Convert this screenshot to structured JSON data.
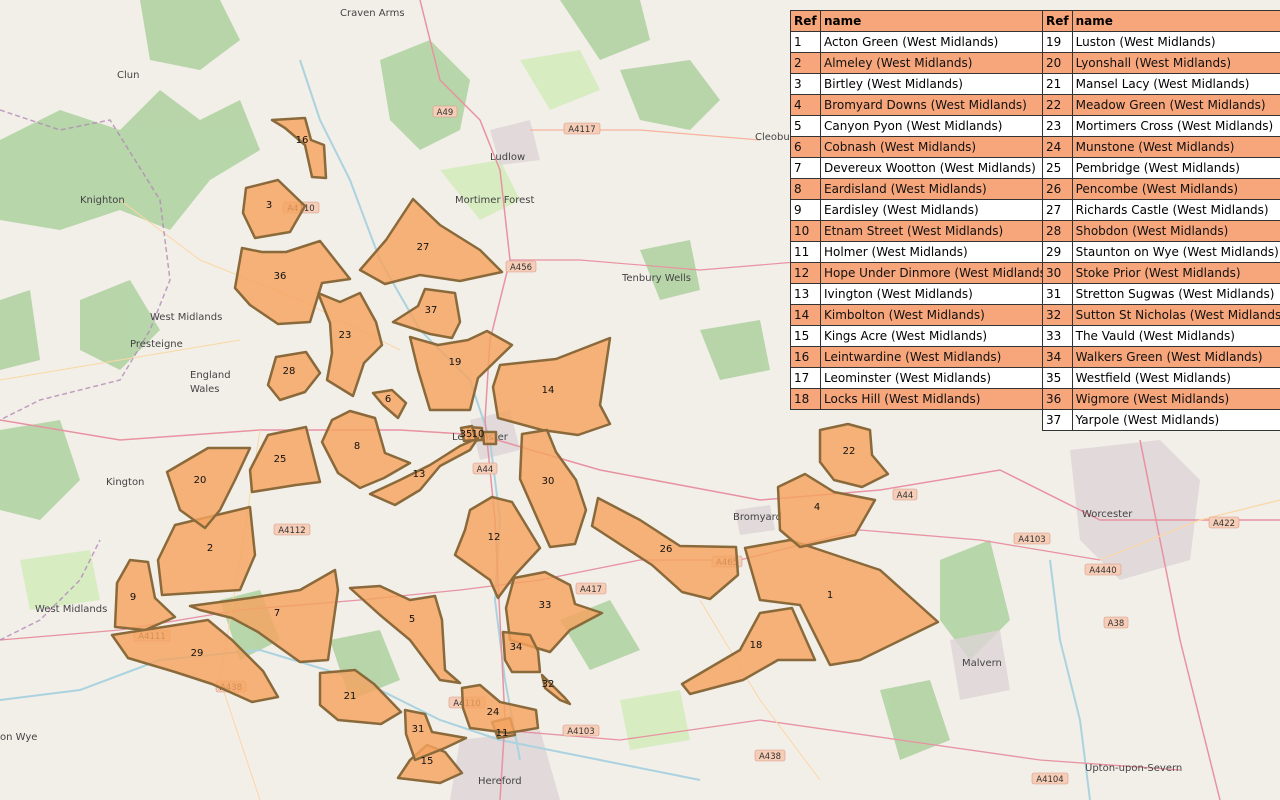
{
  "colors": {
    "area_fill": "#f5a35f",
    "area_stroke": "#8a6a3a",
    "table_header": "#f7a57a",
    "table_alt_row": "#f7a57a"
  },
  "map": {
    "places": [
      {
        "name": "Craven Arms"
      },
      {
        "name": "Clun"
      },
      {
        "name": "Knighton"
      },
      {
        "name": "Ludlow"
      },
      {
        "name": "Mortimer Forest"
      },
      {
        "name": "Cleobury"
      },
      {
        "name": "Tenbury Wells"
      },
      {
        "name": "Presteigne"
      },
      {
        "name": "England"
      },
      {
        "name": "Wales"
      },
      {
        "name": "Kington"
      },
      {
        "name": "Leominster"
      },
      {
        "name": "Bromyard"
      },
      {
        "name": "Worcester"
      },
      {
        "name": "Malvern"
      },
      {
        "name": "Hereford"
      },
      {
        "name": "Upton-upon-Severn"
      },
      {
        "name": "West Midlands"
      },
      {
        "name": "West Midlands"
      },
      {
        "name": "on Wye"
      }
    ],
    "roads": [
      "A49",
      "A4117",
      "A4110",
      "A456",
      "A4112",
      "A44",
      "A4103",
      "A4111",
      "A438",
      "A417",
      "A465",
      "A4440",
      "A38",
      "A422",
      "A4104",
      "A4110",
      "A4103",
      "A438",
      "A44"
    ]
  },
  "legend": {
    "ref_header": "Ref",
    "name_header": "name",
    "left_rows": [
      {
        "ref": "1",
        "name": "Acton Green (West Midlands)"
      },
      {
        "ref": "2",
        "name": "Almeley (West Midlands)"
      },
      {
        "ref": "3",
        "name": "Birtley (West Midlands)"
      },
      {
        "ref": "4",
        "name": "Bromyard Downs (West Midlands)"
      },
      {
        "ref": "5",
        "name": "Canyon Pyon (West Midlands)"
      },
      {
        "ref": "6",
        "name": "Cobnash (West Midlands)"
      },
      {
        "ref": "7",
        "name": "Devereux Wootton (West Midlands)"
      },
      {
        "ref": "8",
        "name": "Eardisland (West Midlands)"
      },
      {
        "ref": "9",
        "name": "Eardisley (West Midlands)"
      },
      {
        "ref": "10",
        "name": "Etnam Street (West Midlands)"
      },
      {
        "ref": "11",
        "name": "Holmer (West Midlands)"
      },
      {
        "ref": "12",
        "name": "Hope Under Dinmore (West Midlands)"
      },
      {
        "ref": "13",
        "name": "Ivington (West Midlands)"
      },
      {
        "ref": "14",
        "name": "Kimbolton (West Midlands)"
      },
      {
        "ref": "15",
        "name": "Kings Acre (West Midlands)"
      },
      {
        "ref": "16",
        "name": "Leintwardine (West Midlands)"
      },
      {
        "ref": "17",
        "name": "Leominster (West Midlands)"
      },
      {
        "ref": "18",
        "name": "Locks Hill (West Midlands)"
      }
    ],
    "right_rows": [
      {
        "ref": "19",
        "name": "Luston (West Midlands)"
      },
      {
        "ref": "20",
        "name": "Lyonshall (West Midlands)"
      },
      {
        "ref": "21",
        "name": "Mansel Lacy (West Midlands)"
      },
      {
        "ref": "22",
        "name": "Meadow Green (West Midlands)"
      },
      {
        "ref": "23",
        "name": "Mortimers Cross (West Midlands)"
      },
      {
        "ref": "24",
        "name": "Munstone (West Midlands)"
      },
      {
        "ref": "25",
        "name": "Pembridge (West Midlands)"
      },
      {
        "ref": "26",
        "name": "Pencombe (West Midlands)"
      },
      {
        "ref": "27",
        "name": "Richards Castle (West Midlands)"
      },
      {
        "ref": "28",
        "name": "Shobdon (West Midlands)"
      },
      {
        "ref": "29",
        "name": "Staunton on Wye (West Midlands)"
      },
      {
        "ref": "30",
        "name": "Stoke Prior (West Midlands)"
      },
      {
        "ref": "31",
        "name": "Stretton Sugwas (West Midlands)"
      },
      {
        "ref": "32",
        "name": "Sutton St Nicholas (West Midlands)"
      },
      {
        "ref": "33",
        "name": "The Vauld (West Midlands)"
      },
      {
        "ref": "34",
        "name": "Walkers Green (West Midlands)"
      },
      {
        "ref": "35",
        "name": "Westfield (West Midlands)"
      },
      {
        "ref": "36",
        "name": "Wigmore (West Midlands)"
      },
      {
        "ref": "37",
        "name": "Yarpole (West Midlands)"
      }
    ]
  },
  "areas": [
    {
      "ref": "1"
    },
    {
      "ref": "2"
    },
    {
      "ref": "3"
    },
    {
      "ref": "4"
    },
    {
      "ref": "5"
    },
    {
      "ref": "6"
    },
    {
      "ref": "7"
    },
    {
      "ref": "8"
    },
    {
      "ref": "9"
    },
    {
      "ref": "10"
    },
    {
      "ref": "11"
    },
    {
      "ref": "12"
    },
    {
      "ref": "13"
    },
    {
      "ref": "14"
    },
    {
      "ref": "15"
    },
    {
      "ref": "16"
    },
    {
      "ref": "17"
    },
    {
      "ref": "18"
    },
    {
      "ref": "19"
    },
    {
      "ref": "20"
    },
    {
      "ref": "21"
    },
    {
      "ref": "22"
    },
    {
      "ref": "23"
    },
    {
      "ref": "24"
    },
    {
      "ref": "25"
    },
    {
      "ref": "26"
    },
    {
      "ref": "27"
    },
    {
      "ref": "28"
    },
    {
      "ref": "29"
    },
    {
      "ref": "30"
    },
    {
      "ref": "31"
    },
    {
      "ref": "32"
    },
    {
      "ref": "33"
    },
    {
      "ref": "34"
    },
    {
      "ref": "35"
    },
    {
      "ref": "36"
    },
    {
      "ref": "37"
    }
  ]
}
